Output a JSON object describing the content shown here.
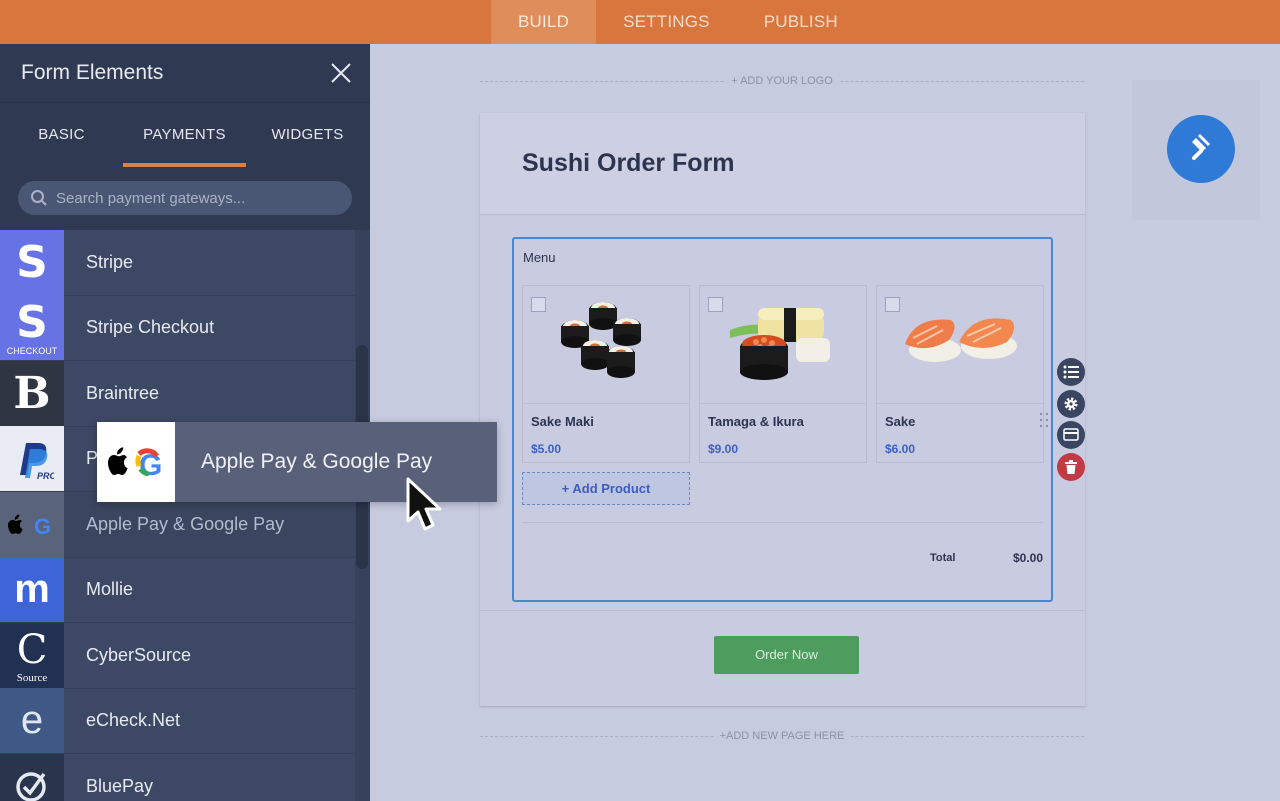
{
  "topnav": {
    "tabs": [
      "BUILD",
      "SETTINGS",
      "PUBLISH"
    ],
    "active": "BUILD"
  },
  "sidebar": {
    "title": "Form Elements",
    "tabs": [
      "BASIC",
      "PAYMENTS",
      "WIDGETS"
    ],
    "active_tab": "PAYMENTS",
    "search_placeholder": "Search payment gateways...",
    "icon_letters": {
      "stripe": "S",
      "braintree": "B",
      "mollie": "m",
      "cybersource": "C",
      "echeck": "e"
    },
    "icon_captions": {
      "stripe_checkout": "CHECKOUT",
      "cybersource": "Source"
    },
    "items": [
      {
        "label": "Stripe",
        "icon": "stripe-icon"
      },
      {
        "label": "Stripe Checkout",
        "icon": "stripe-checkout-icon"
      },
      {
        "label": "Braintree",
        "icon": "braintree-icon"
      },
      {
        "label": "PayPal Pro",
        "icon": "paypal-pro-icon",
        "visible_text": "P"
      },
      {
        "label": "Apple Pay & Google Pay",
        "icon": "apple-google-pay-icon"
      },
      {
        "label": "Mollie",
        "icon": "mollie-icon"
      },
      {
        "label": "CyberSource",
        "icon": "cybersource-icon"
      },
      {
        "label": "eCheck.Net",
        "icon": "echeck-icon"
      },
      {
        "label": "BluePay",
        "icon": "bluepay-icon"
      }
    ]
  },
  "drag_ghost": {
    "label": "Apple Pay & Google Pay",
    "icon": "apple-google-pay-icon"
  },
  "form": {
    "add_logo": "+ ADD YOUR LOGO",
    "title": "Sushi Order Form",
    "menu_label": "Menu",
    "products": [
      {
        "name": "Sake Maki",
        "price": "$5.00"
      },
      {
        "name": "Tamaga & Ikura",
        "price": "$9.00"
      },
      {
        "name": "Sake",
        "price": "$6.00"
      }
    ],
    "add_product": "+ Add Product",
    "total_label": "Total",
    "total_value": "$0.00",
    "submit": "Order Now",
    "add_page": "+ADD NEW PAGE HERE"
  },
  "colors": {
    "topbar": "#d9763e",
    "sidebar": "#3b4761",
    "accent": "#e07f42",
    "brush": "#2f7ad6",
    "order": "#4c9d5e",
    "delete": "#c23a44"
  }
}
